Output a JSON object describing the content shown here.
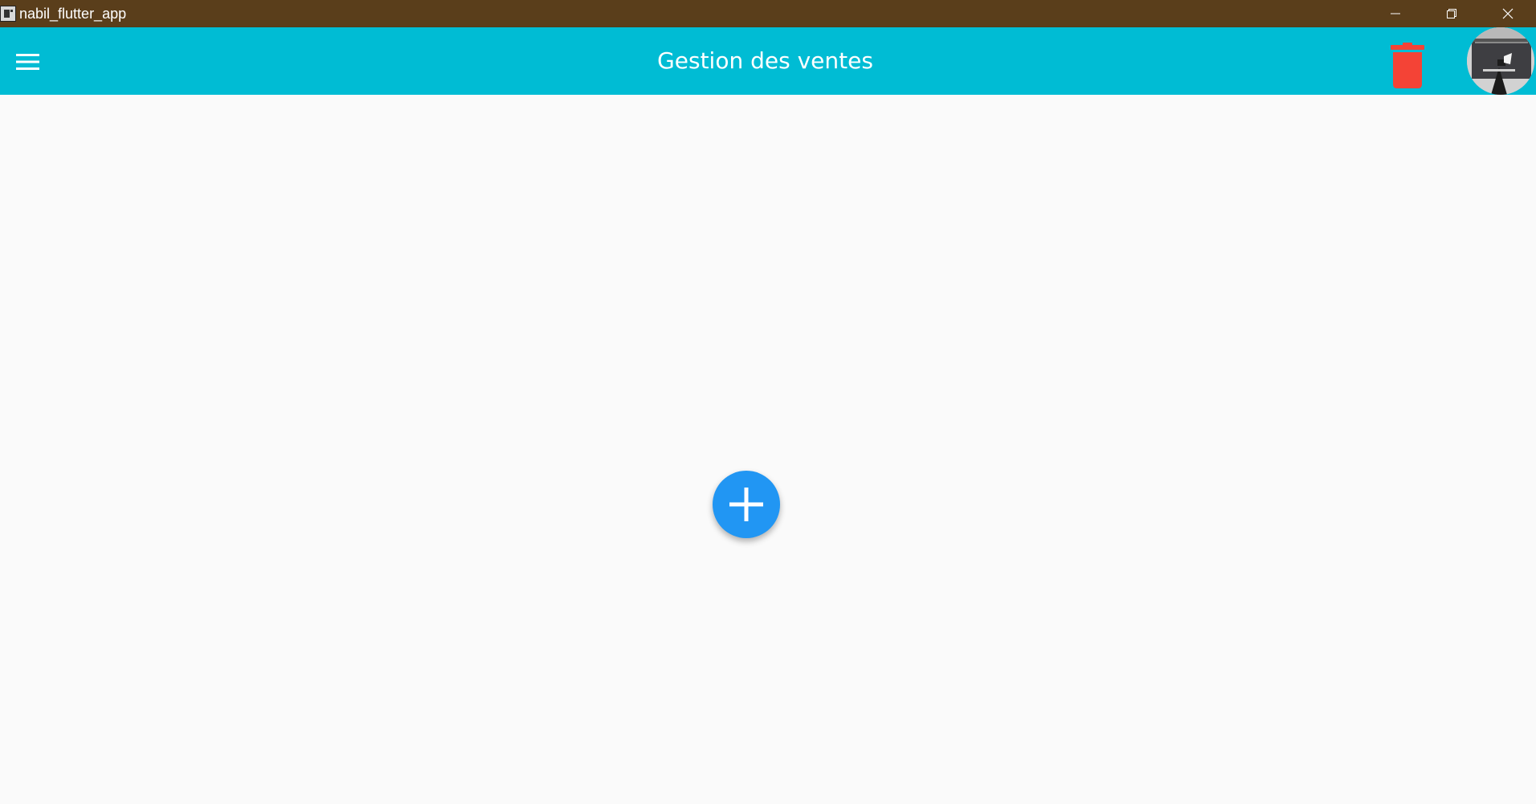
{
  "window": {
    "title": "nabil_flutter_app",
    "controls": {
      "minimize_icon": "minimize-icon",
      "maximize_icon": "restore-icon",
      "close_icon": "close-icon"
    }
  },
  "appbar": {
    "title": "Gestion des ventes",
    "menu_icon": "hamburger-menu-icon",
    "delete_icon": "trash-icon",
    "avatar": "profile-avatar"
  },
  "main": {
    "fab_icon": "add-icon"
  },
  "colors": {
    "titlebar": "#5a3e1b",
    "appbar": "#00bcd4",
    "background": "#fafafa",
    "delete": "#f44336",
    "fab": "#2196f3"
  }
}
